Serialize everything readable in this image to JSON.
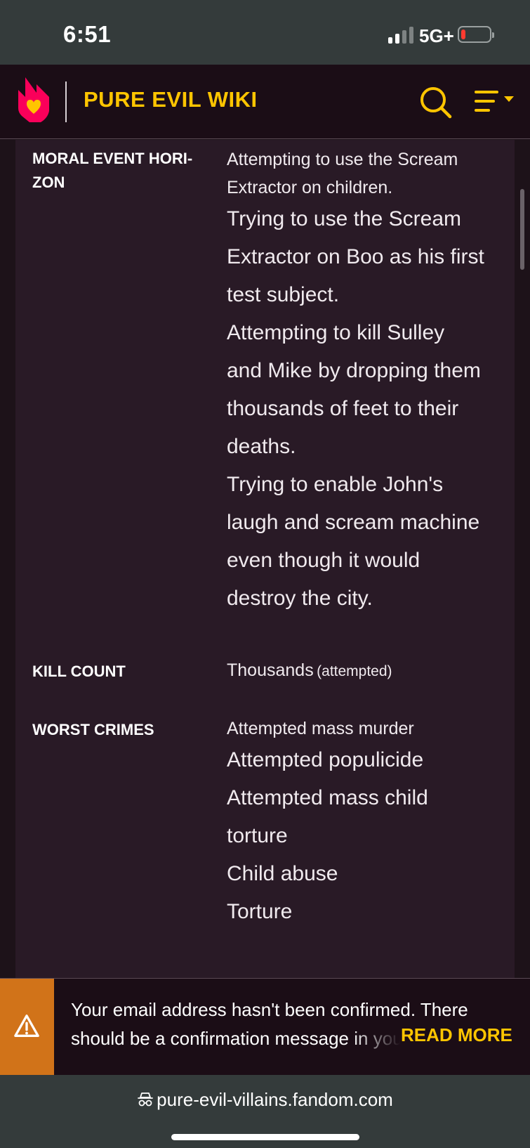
{
  "status_bar": {
    "time": "6:51",
    "network": "5G+",
    "battery_level": 0.15,
    "signal_bars_active": 2
  },
  "header": {
    "wiki_title": "PURE EVIL WIKI",
    "logo_icon": "fandom-heart-flame-icon",
    "search_icon": "search-icon",
    "menu_icon": "menu-icon"
  },
  "infobox": {
    "rows": [
      {
        "label_line1": "MORAL EVENT HORI-",
        "label_line2": "ZON",
        "values": [
          "Attempting to use the Scream",
          "Extractor on children.",
          "Trying to use the Scream",
          "Extractor on Boo as his first",
          "test subject.",
          "Attempting to kill Sulley",
          "and Mike by dropping them",
          "thousands of feet to their",
          "deaths.",
          "Trying to enable John's",
          "laugh and scream machine",
          "even though it would",
          "destroy the city."
        ]
      },
      {
        "label_line1": "KILL COUNT",
        "value_main": "Thousands",
        "value_note": "(attempted)"
      },
      {
        "label_line1": "WORST CRIMES",
        "values": [
          "Attempted mass murder",
          "Attempted populicide",
          "Attempted mass child",
          "torture",
          "Child abuse",
          "Torture"
        ]
      }
    ]
  },
  "banner": {
    "line1": "Your email address hasn't been confirmed. There",
    "line2": "should be a confirmation message in your inbox.",
    "read_more": "READ MORE",
    "warning_icon": "warning-icon",
    "accent_color": "#d17319"
  },
  "address_bar": {
    "url": "pure-evil-villains.fandom.com",
    "incognito_icon": "incognito-icon"
  },
  "colors": {
    "brand_yellow": "#ffc500",
    "brand_pink": "#fa005a",
    "infobox_bg": "#291a26"
  }
}
